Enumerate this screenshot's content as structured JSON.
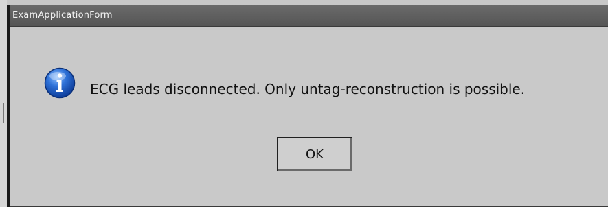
{
  "window": {
    "title": "ExamApplicationForm"
  },
  "dialog": {
    "icon": "info-icon",
    "message": "ECG leads disconnected. Only untag-reconstruction is possible.",
    "ok_label": "OK"
  },
  "colors": {
    "titlebar": "#5e5e5e",
    "body": "#c9c9c9",
    "icon_blue": "#1f5fc4"
  }
}
